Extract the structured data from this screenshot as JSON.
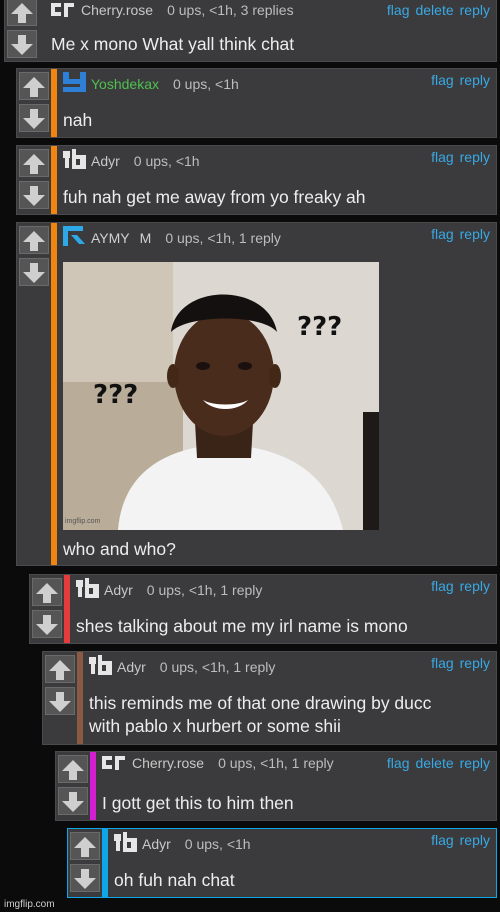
{
  "comments": [
    {
      "user": "Cherry.rose",
      "meta": "0 ups, <1h, 3 replies",
      "actions": [
        "flag",
        "delete",
        "reply"
      ],
      "text": "Me x mono What yall think chat",
      "accent": "#3b3b3d"
    },
    {
      "user": "Yoshdekax",
      "meta": "0 ups, <1h",
      "actions": [
        "flag",
        "reply"
      ],
      "text": "nah",
      "accent": "#f0860f"
    },
    {
      "user": "Adyr",
      "meta": "0 ups, <1h",
      "actions": [
        "flag",
        "reply"
      ],
      "text": "fuh nah get me away from yo freaky ah",
      "accent": "#f0860f"
    },
    {
      "user": "AYMY",
      "user_extra": "M",
      "meta": "0 ups, <1h, 1 reply",
      "actions": [
        "flag",
        "reply"
      ],
      "text": "who and who?",
      "accent": "#f0860f",
      "image": {
        "caption_left": "???",
        "caption_right": "???",
        "watermark": "imgflip.com"
      }
    },
    {
      "user": "Adyr",
      "meta": "0 ups, <1h, 1 reply",
      "actions": [
        "flag",
        "reply"
      ],
      "text": "shes talking about me my irl name is mono",
      "accent": "#e23c3c"
    },
    {
      "user": "Adyr",
      "meta": "0 ups, <1h, 1 reply",
      "actions": [
        "flag",
        "reply"
      ],
      "text_lines": [
        "this reminds me of that one drawing by ducc",
        "with pablo x hurbert or some shii"
      ],
      "accent": "#8b5a44"
    },
    {
      "user": "Cherry.rose",
      "meta": "0 ups, <1h, 1 reply",
      "actions": [
        "flag",
        "delete",
        "reply"
      ],
      "text": "I gott get this to him then",
      "accent": "#d21fd2"
    },
    {
      "user": "Adyr",
      "meta": "0 ups, <1h",
      "actions": [
        "flag",
        "reply"
      ],
      "text": "oh fuh nah chat",
      "accent": "#0ea6e8"
    }
  ],
  "footer": "imgflip.com",
  "colors": {
    "link": "#38a9e4",
    "panel": "#3b3b3d",
    "background": "#0b0b0b"
  }
}
